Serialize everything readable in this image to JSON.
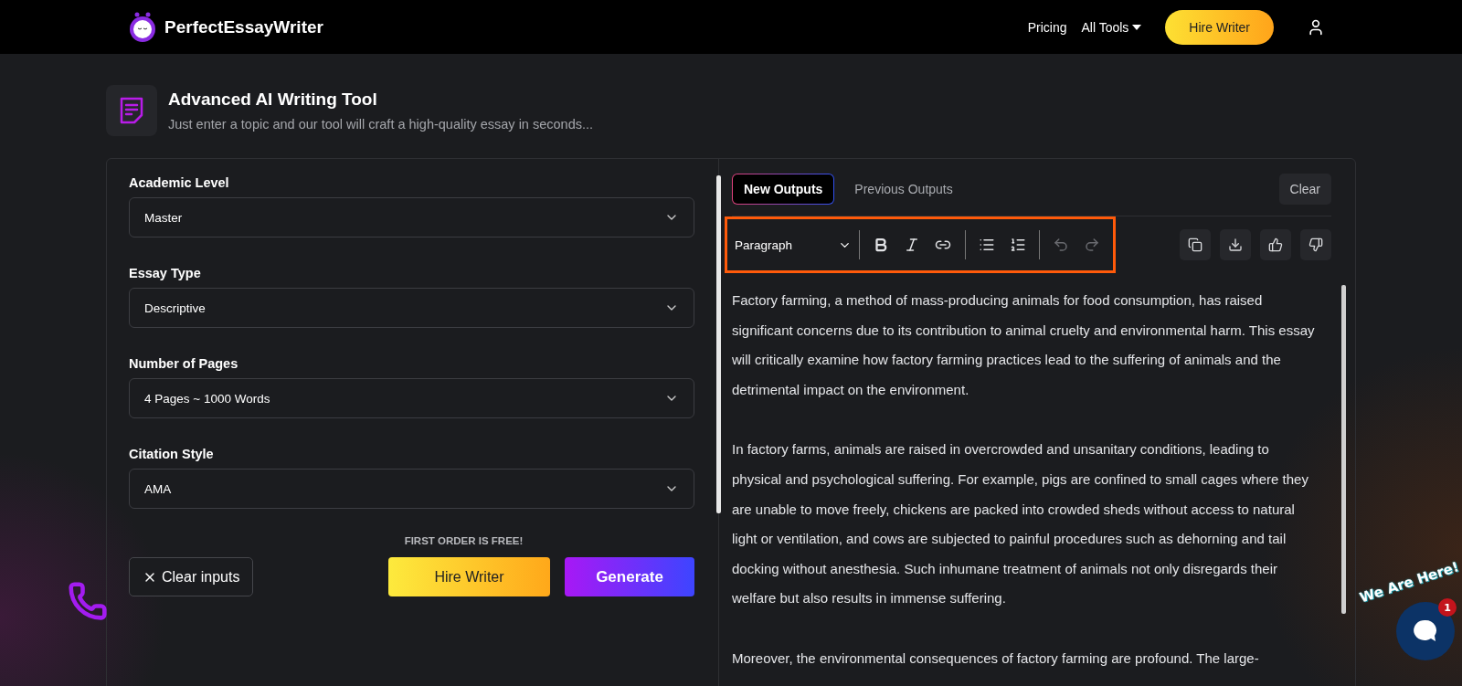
{
  "header": {
    "brand": "PerfectEssayWriter",
    "nav": [
      {
        "label": "Pricing",
        "kind": "link"
      },
      {
        "label": "All Tools",
        "kind": "dropdown"
      }
    ],
    "cta": "Hire Writer"
  },
  "tool": {
    "title": "Advanced AI Writing Tool",
    "subtitle": "Just enter a topic and our tool will craft a high-quality essay in seconds..."
  },
  "form": {
    "fields": [
      {
        "label": "Academic Level",
        "value": "Master"
      },
      {
        "label": "Essay Type",
        "value": "Descriptive"
      },
      {
        "label": "Number of Pages",
        "value": "4 Pages ~ 1000 Words"
      },
      {
        "label": "Citation Style",
        "value": "AMA"
      }
    ],
    "free_note": "FIRST ORDER IS FREE!",
    "clear_button": "Clear inputs",
    "hire_button": "Hire Writer",
    "generate_button": "Generate"
  },
  "output": {
    "tabs": [
      {
        "label": "New Outputs",
        "selected": true
      },
      {
        "label": "Previous Outputs",
        "selected": false
      }
    ],
    "clear_button": "Clear",
    "toolbar": {
      "block_format": "Paragraph",
      "tools": [
        {
          "kind": "bold",
          "disabled": false
        },
        {
          "kind": "italic",
          "disabled": false
        },
        {
          "kind": "link",
          "disabled": false
        },
        {
          "kind": "bullets",
          "disabled": false
        },
        {
          "kind": "numbers",
          "disabled": false
        },
        {
          "kind": "undo",
          "disabled": true
        },
        {
          "kind": "redo",
          "disabled": true
        }
      ]
    },
    "actions": [
      {
        "kind": "copy"
      },
      {
        "kind": "download"
      },
      {
        "kind": "like"
      },
      {
        "kind": "dislike"
      }
    ],
    "paragraphs": [
      "Factory farming, a method of mass-producing animals for food consumption, has raised significant concerns due to its contribution to animal cruelty and environmental harm. This essay will critically examine how factory farming practices lead to the suffering of animals and the detrimental impact on the environment.",
      "In factory farms, animals are raised in overcrowded and unsanitary conditions, leading to physical and psychological suffering. For example, pigs are confined to small cages where they are unable to move freely, chickens are packed into crowded sheds without access to natural light or ventilation, and cows are subjected to painful procedures such as dehorning and tail docking without anesthesia. Such inhumane treatment of animals not only disregards their welfare but also results in immense suffering.",
      "Moreover, the environmental consequences of factory farming are profound. The large-"
    ]
  },
  "chat": {
    "banner": "We Are Here!",
    "badge": "1"
  }
}
